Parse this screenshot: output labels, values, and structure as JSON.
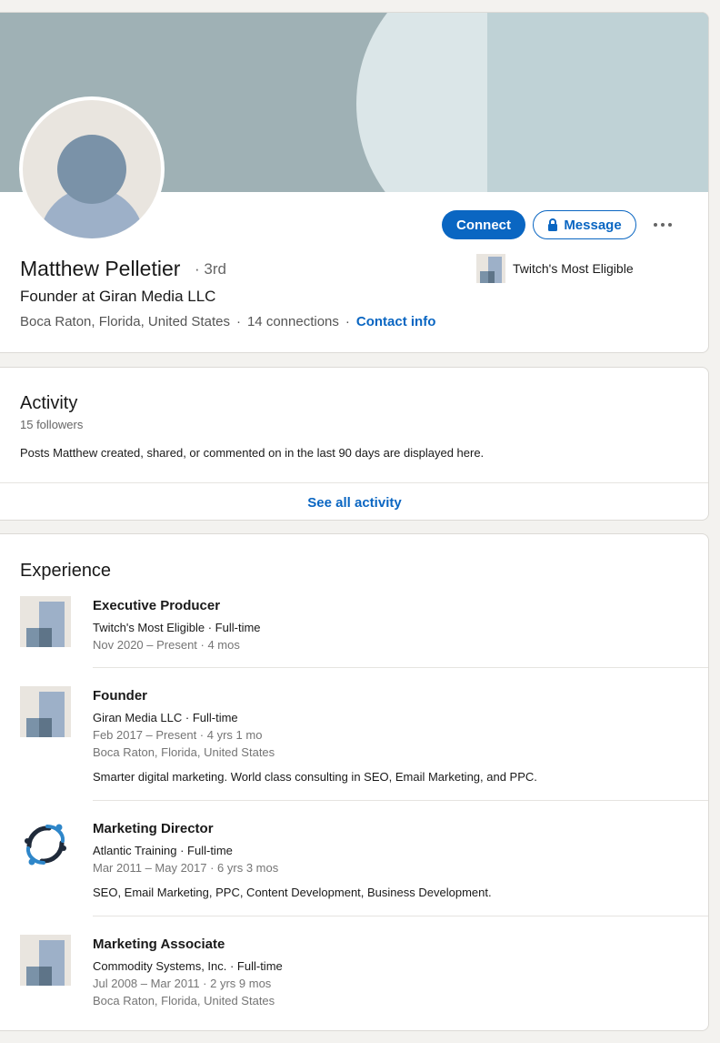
{
  "profile": {
    "name": "Matthew Pelletier",
    "degree": "· 3rd",
    "headline": "Founder at Giran Media LLC",
    "location": "Boca Raton, Florida, United States",
    "connections": "14 connections",
    "separator": "·",
    "contact_label": "Contact info",
    "current_company": "Twitch's Most Eligible"
  },
  "actions": {
    "connect_label": "Connect",
    "message_label": "Message",
    "more_icon": "ellipsis-icon",
    "lock_icon": "lock-icon"
  },
  "activity": {
    "title": "Activity",
    "followers": "15 followers",
    "description": "Posts Matthew created, shared, or commented on in the last 90 days are displayed here.",
    "see_all_label": "See all activity"
  },
  "experience": {
    "title": "Experience",
    "items": [
      {
        "title": "Executive Producer",
        "company": "Twitch's Most Eligible · Full-time",
        "dates": "Nov 2020 – Present · 4 mos",
        "location": "",
        "description": "",
        "logo": "placeholder-company-icon"
      },
      {
        "title": "Founder",
        "company": "Giran Media LLC · Full-time",
        "dates": "Feb 2017 – Present · 4 yrs 1 mo",
        "location": "Boca Raton, Florida, United States",
        "description": "Smarter digital marketing. World class consulting in SEO, Email Marketing, and PPC.",
        "logo": "placeholder-company-icon"
      },
      {
        "title": "Marketing Director",
        "company": "Atlantic Training · Full-time",
        "dates": "Mar 2011 – May 2017 · 6 yrs 3 mos",
        "location": "",
        "description": "SEO, Email Marketing, PPC, Content Development, Business Development.",
        "logo": "atlantic-training-logo"
      },
      {
        "title": "Marketing Associate",
        "company": "Commodity Systems, Inc. · Full-time",
        "dates": "Jul 2008 – Mar 2011 · 2 yrs 9 mos",
        "location": "Boca Raton, Florida, United States",
        "description": "",
        "logo": "placeholder-company-icon"
      }
    ]
  },
  "colors": {
    "accent": "#0a66c2",
    "page_bg": "#f3f2ef",
    "banner": "#9fb1b5"
  }
}
